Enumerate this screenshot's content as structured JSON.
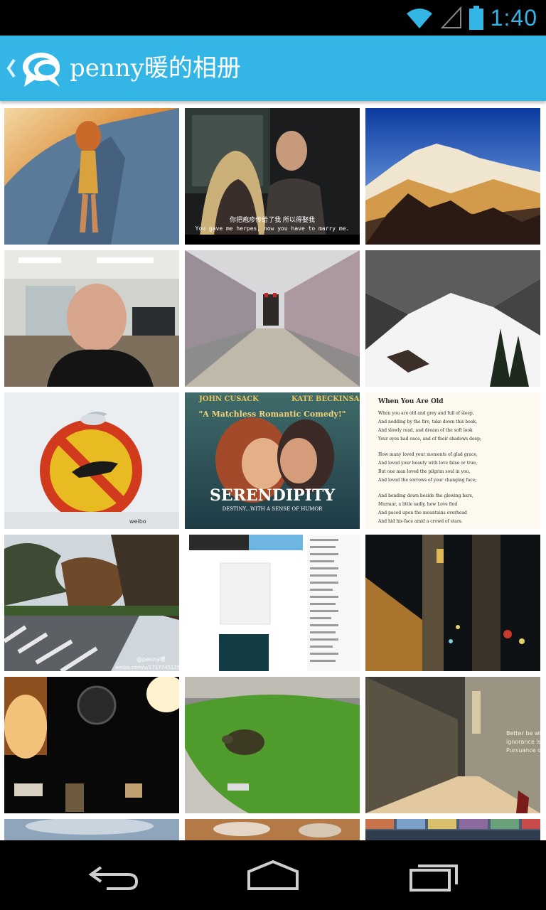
{
  "status_bar": {
    "time": "1:40",
    "icons": [
      "wifi-icon",
      "cell-signal-icon",
      "battery-icon"
    ]
  },
  "action_bar": {
    "title": "penny暖的相册",
    "background": "#33b5e5",
    "icons": [
      "up-caret-icon",
      "chat-bubbles-icon"
    ]
  },
  "photos": {
    "tiles": [
      {
        "id": 1,
        "subject": "animated figure"
      },
      {
        "id": 2,
        "subject": "tv still",
        "subtitle_cn": "你把疱疹传给了我 所以得娶我",
        "subtitle_en": "You gave me herpes, now you have to marry me."
      },
      {
        "id": 3,
        "subject": "mountains"
      },
      {
        "id": 4,
        "subject": "office selfie"
      },
      {
        "id": 5,
        "subject": "alley"
      },
      {
        "id": 6,
        "subject": "snowy valley"
      },
      {
        "id": 7,
        "subject": "gull on sign",
        "watermark": "weibo"
      },
      {
        "id": 8,
        "subject": "movie poster",
        "actor_left": "JOHN CUSACK",
        "actor_right": "KATE BECKINSALE",
        "tagline": "\"A Matchless Romantic Comedy!\"",
        "movie_title": "SERENDIPITY",
        "subtitle": "DESTINY...WITH A SENSE OF HUMOR"
      },
      {
        "id": 9,
        "subject": "poem",
        "poem_title": "When You Are Old",
        "poem_lines": [
          "When you are old and grey and full of sleep,",
          "And nodding by the fire, take down this book,",
          "And slowly read, and dream of the soft look",
          "Your eyes had once, and of their shadows deep;",
          "How many loved your moments of glad grace,",
          "And loved your beauty with love false or true,",
          "But one man loved the pilgrim soul in you,",
          "And loved the sorrows of your changing face;",
          "And bending down beside the glowing bars,",
          "Murmur, a little sadly, how Love fled",
          "And paced upon the mountains overhead",
          "And hid his face amid a crowd of stars."
        ]
      },
      {
        "id": 10,
        "subject": "street",
        "watermark_name": "@penny暖",
        "watermark_url": "weibo.com/u/1717745125"
      },
      {
        "id": 11,
        "subject": "webpage screenshot"
      },
      {
        "id": 12,
        "subject": "night window"
      },
      {
        "id": 13,
        "subject": "cafe lamps"
      },
      {
        "id": 14,
        "subject": "turtle pond"
      },
      {
        "id": 15,
        "subject": "corridor",
        "wall_text": [
          "Better be with",
          "ignorance is the",
          "Pursuance of ele"
        ]
      },
      {
        "id": 16,
        "subject": "sky"
      },
      {
        "id": 17,
        "subject": "table"
      },
      {
        "id": 18,
        "subject": "collage"
      }
    ]
  },
  "nav_bar": {
    "buttons": [
      "back-icon",
      "home-icon",
      "recent-apps-icon"
    ]
  }
}
